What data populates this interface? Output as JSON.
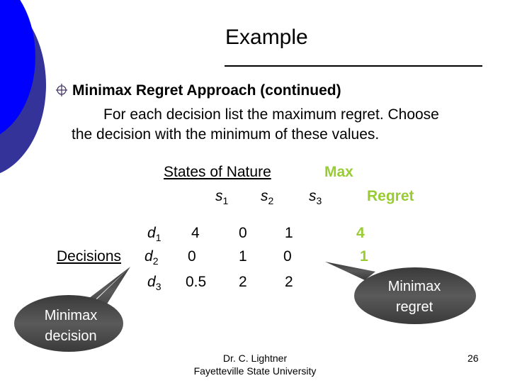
{
  "slide": {
    "title": "Example",
    "bullet_icon": "circle-crosshair-icon",
    "heading": "Minimax Regret Approach (continued)",
    "paragraph_line1": "For each decision list the maximum regret.  Choose",
    "paragraph_line2": "the decision with the minimum of these values."
  },
  "table": {
    "states_header": "States of Nature",
    "max_regret_header_line1": "Max",
    "max_regret_header_line2": "Regret",
    "decisions_label": "Decisions",
    "states": [
      {
        "letter": "s",
        "sub": "1"
      },
      {
        "letter": "s",
        "sub": "2"
      },
      {
        "letter": "s",
        "sub": "3"
      }
    ],
    "rows": [
      {
        "letter": "d",
        "sub": "1",
        "values": [
          "4",
          "0",
          "1"
        ],
        "max_regret": "4"
      },
      {
        "letter": "d",
        "sub": "2",
        "values": [
          "0",
          "1",
          "0"
        ],
        "max_regret": "1"
      },
      {
        "letter": "d",
        "sub": "3",
        "values": [
          "0.5",
          "2",
          "2"
        ],
        "max_regret": ""
      }
    ]
  },
  "callouts": {
    "decision_line1": "Minimax",
    "decision_line2": "decision",
    "regret_line1": "Minimax",
    "regret_line2": "regret"
  },
  "footer": {
    "author": "Dr. C. Lightner",
    "institution": "Fayetteville State University",
    "page_number": "26"
  },
  "colors": {
    "accent_green": "#99cc33",
    "circle_blue": "#0000ff",
    "circle_navy": "#333399",
    "callout_gray": "#4d4d4d"
  }
}
